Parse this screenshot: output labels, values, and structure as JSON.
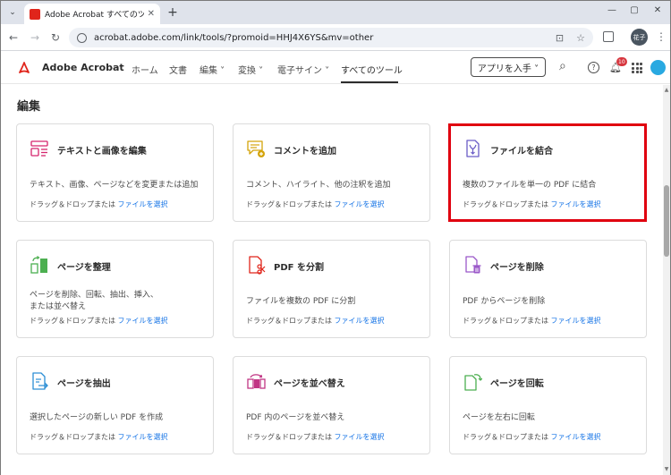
{
  "browser": {
    "tab_title": "Adobe Acrobat すべてのツール",
    "tab_close": "✕",
    "new_tab": "+",
    "url": "acrobat.adobe.com/link/tools/?promoid=HHJ4X6YS&mv=other",
    "profile_label": "花子",
    "back": "←",
    "forward": "→",
    "reload": "↻",
    "install": "⊡",
    "star": "☆",
    "kebab": "⋮",
    "minimize": "—",
    "maximize": "▢",
    "close": "✕",
    "tab_menu": "⌄"
  },
  "appnav": {
    "brand": "Adobe Acrobat",
    "items": [
      {
        "label": "ホーム"
      },
      {
        "label": "文書"
      },
      {
        "label": "編集 ˅"
      },
      {
        "label": "変換 ˅"
      },
      {
        "label": "電子サイン ˅"
      },
      {
        "label": "すべてのツール"
      }
    ],
    "get_app": "アプリを入手 ˅",
    "notification_count": "10",
    "search_glyph": "⌕",
    "help_glyph": "?",
    "bell_glyph": "🔔︎"
  },
  "section": {
    "title": "編集"
  },
  "cards": [
    {
      "title": "テキストと画像を編集",
      "desc": "テキスト、画像、ページなどを変更または追加",
      "foot_prefix": "ドラッグ＆ドロップまたは",
      "foot_link": "ファイルを選択"
    },
    {
      "title": "コメントを追加",
      "desc": "コメント、ハイライト、他の注釈を追加",
      "foot_prefix": "ドラッグ＆ドロップまたは",
      "foot_link": "ファイルを選択"
    },
    {
      "title": "ファイルを結合",
      "desc": "複数のファイルを単一の PDF に結合",
      "foot_prefix": "ドラッグ＆ドロップまたは",
      "foot_link": "ファイルを選択"
    },
    {
      "title": "ページを整理",
      "desc": "ページを削除、回転、抽出、挿入、\nまたは並べ替え",
      "foot_prefix": "ドラッグ＆ドロップまたは",
      "foot_link": "ファイルを選択"
    },
    {
      "title": "PDF を分割",
      "desc": "ファイルを複数の PDF に分割",
      "foot_prefix": "ドラッグ＆ドロップまたは",
      "foot_link": "ファイルを選択"
    },
    {
      "title": "ページを削除",
      "desc": "PDF からページを削除",
      "foot_prefix": "ドラッグ＆ドロップまたは",
      "foot_link": "ファイルを選択"
    },
    {
      "title": "ページを抽出",
      "desc": "選択したページの新しい PDF を作成",
      "foot_prefix": "ドラッグ＆ドロップまたは",
      "foot_link": "ファイルを選択"
    },
    {
      "title": "ページを並べ替え",
      "desc": "PDF 内のページを並べ替え",
      "foot_prefix": "ドラッグ＆ドロップまたは",
      "foot_link": "ファイルを選択"
    },
    {
      "title": "ページを回転",
      "desc": "ページを左右に回転",
      "foot_prefix": "ドラッグ＆ドロップまたは",
      "foot_link": "ファイルを選択"
    }
  ],
  "colors": {
    "accent": "#1473e6",
    "acrobat_red": "#e0251b",
    "highlight_border": "#e0000f"
  },
  "icons": [
    "edit-text-image-icon",
    "add-comment-icon",
    "combine-files-icon",
    "organize-pages-icon",
    "split-pdf-icon",
    "delete-pages-icon",
    "extract-pages-icon",
    "reorder-pages-icon",
    "rotate-pages-icon"
  ]
}
